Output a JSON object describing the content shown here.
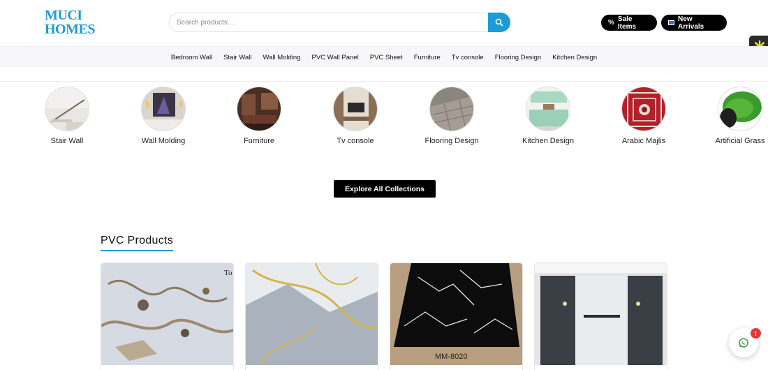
{
  "brand": {
    "logo_line1": "MUCI",
    "logo_line2": "HOMES",
    "accent_color": "#1e9ad8"
  },
  "search": {
    "placeholder": "Search products...",
    "value": ""
  },
  "header_buttons": {
    "sale_label": "Sale Items",
    "sale_icon": "%",
    "arrivals_label": "New Arrivals"
  },
  "nav": {
    "items": [
      "Bedroom Wall",
      "Stair Wall",
      "Wall Molding",
      "PVC Wall Panel",
      "PVC Sheet",
      "Furniture",
      "Tv console",
      "Flooring Design",
      "Kitchen Design"
    ]
  },
  "categories": [
    {
      "label": "Stair Wall",
      "icon": "stair-wall-image"
    },
    {
      "label": "Wall Molding",
      "icon": "wall-molding-image"
    },
    {
      "label": "Furniture",
      "icon": "furniture-image"
    },
    {
      "label": "Tv console",
      "icon": "tv-console-image"
    },
    {
      "label": "Flooring Design",
      "icon": "flooring-image"
    },
    {
      "label": "Kitchen Design",
      "icon": "kitchen-image"
    },
    {
      "label": "Arabic Majlis",
      "icon": "arabic-majlis-image"
    },
    {
      "label": "Artificial Grass",
      "icon": "artificial-grass-image"
    }
  ],
  "explore_label": "Explore All Collections",
  "section": {
    "title": "PVC Products"
  },
  "products": [
    {
      "image_text": "To"
    },
    {
      "image_text": ""
    },
    {
      "image_text": "MM-8020"
    },
    {
      "image_text": ""
    }
  ],
  "whatsapp": {
    "badge": "!"
  }
}
